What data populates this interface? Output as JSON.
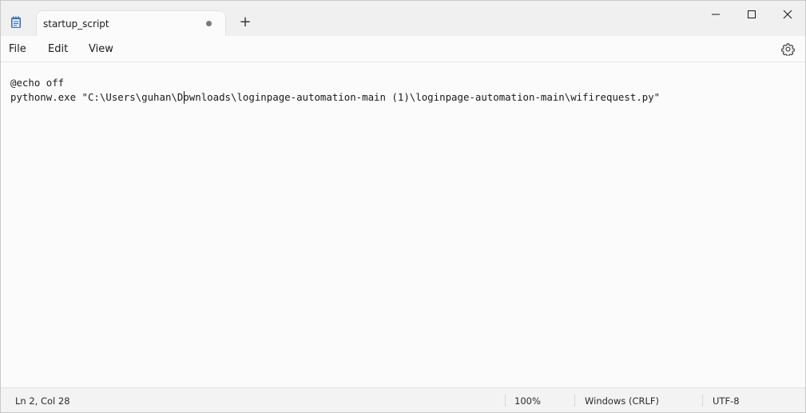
{
  "tab": {
    "title": "startup_script",
    "modified_indicator": "unsaved-dot",
    "new_tab_label": "+"
  },
  "window_controls": {
    "minimize": "minimize-icon",
    "maximize": "maximize-icon",
    "close": "close-icon"
  },
  "menu": {
    "file": "File",
    "edit": "Edit",
    "view": "View",
    "settings_icon": "gear-icon"
  },
  "editor": {
    "lines": [
      "@echo off",
      "pythonw.exe \"C:\\Users\\guhan\\Downloads\\loginpage-automation-main (1)\\loginpage-automation-main\\wifirequest.py\""
    ]
  },
  "status": {
    "position": "Ln 2, Col 28",
    "zoom": "100%",
    "line_ending": "Windows (CRLF)",
    "encoding": "UTF-8"
  },
  "colors": {
    "background": "#f9f9f9",
    "titlebar": "#f0f0f0",
    "accent": "#3a6fb0"
  }
}
